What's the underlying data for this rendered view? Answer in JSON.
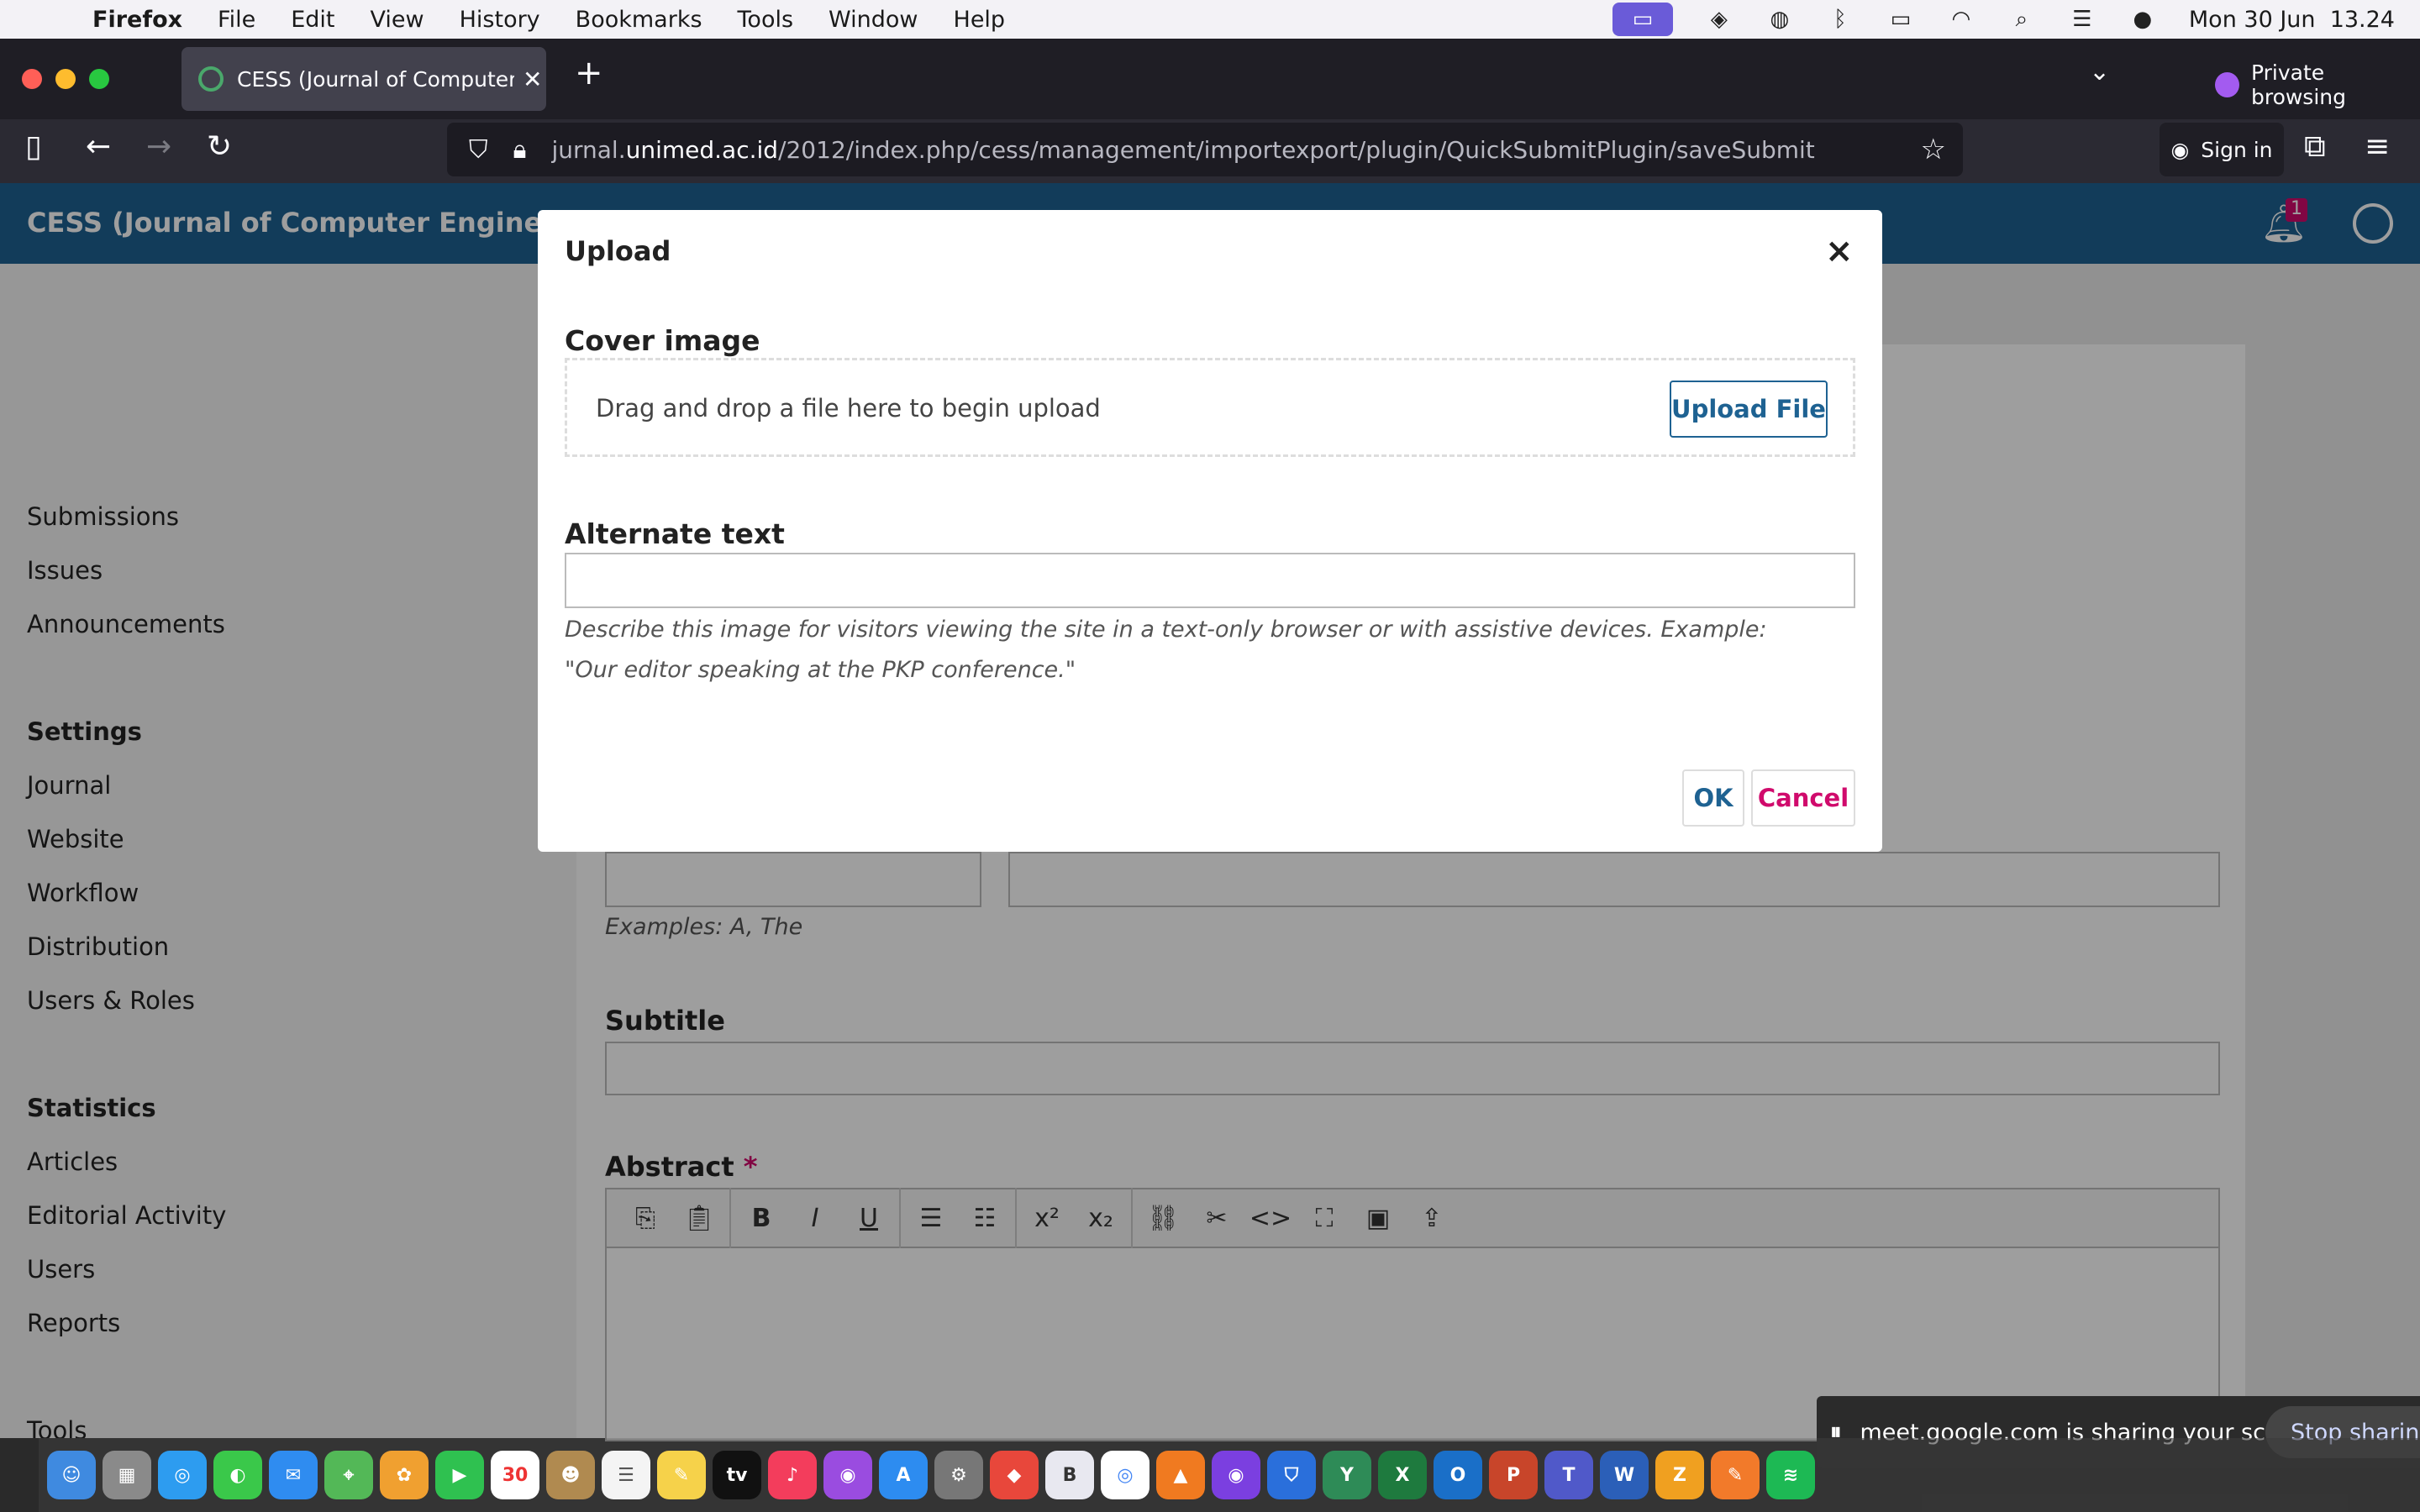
{
  "menubar": {
    "apple_glyph": "",
    "app": "Firefox",
    "items": [
      "File",
      "Edit",
      "View",
      "History",
      "Bookmarks",
      "Tools",
      "Window",
      "Help"
    ],
    "clock": "Mon 30 Jun  13.24"
  },
  "browser": {
    "tab_title": "CESS (Journal of Computer Eng",
    "url_prefix": "jurnal.",
    "url_domain": "unimed.ac.id",
    "url_path": "/2012/index.php/cess/management/importexport/plugin/QuickSubmitPlugin/saveSubmit",
    "private_label": "Private browsing",
    "sign_in": "Sign in"
  },
  "site": {
    "title": "CESS (Journal of Computer Engineering",
    "notification_count": "1"
  },
  "sidebar": {
    "main": [
      "Submissions",
      "Issues",
      "Announcements"
    ],
    "settings_heading": "Settings",
    "settings": [
      "Journal",
      "Website",
      "Workflow",
      "Distribution",
      "Users & Roles"
    ],
    "statistics_heading": "Statistics",
    "statistics": [
      "Articles",
      "Editorial Activity",
      "Users",
      "Reports"
    ],
    "tools": "Tools"
  },
  "form": {
    "prefix_hint": "Examples: A, The",
    "subtitle_label": "Subtitle",
    "abstract_label": "Abstract",
    "required_mark": "*"
  },
  "modal": {
    "title": "Upload",
    "close_glyph": "×",
    "cover_label": "Cover image",
    "drop_text": "Drag and drop a file here to begin upload",
    "upload_button": "Upload File",
    "alt_label": "Alternate text",
    "alt_value": "",
    "alt_hint": "Describe this image for visitors viewing the site in a text-only browser or with assistive devices. Example: \"Our editor speaking at the PKP conference.\"",
    "ok": "OK",
    "cancel": "Cancel"
  },
  "share": {
    "message": "meet.google.com is sharing your screen.",
    "stop": "Stop sharing"
  },
  "dock": {
    "calendar_day": "30"
  },
  "colors": {
    "header": "#1e6292",
    "accent": "#d00a6c",
    "private": "#a35bf0"
  }
}
